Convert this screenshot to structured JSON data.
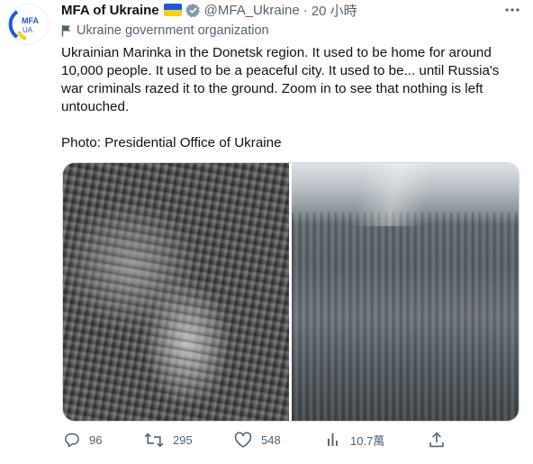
{
  "account": {
    "display_name": "MFA of Ukraine",
    "handle": "@MFA_Ukraine",
    "separator": "·",
    "time": "20 小時",
    "affiliation": "Ukraine government organization",
    "avatar_text_top": "MFA",
    "avatar_text_bottom": "UA"
  },
  "tweet": {
    "text": "Ukrainian Marinka in the Donetsk region. It used to be home for around 10,000 people. It used to be a peaceful city. It used to be... until Russia's war criminals razed it to the ground. Zoom in to see that nothing is left untouched.",
    "photo_credit": "Photo: Presidential Office of Ukraine"
  },
  "actions": {
    "reply_count": "96",
    "retweet_count": "295",
    "like_count": "548",
    "views_count": "10.7萬"
  },
  "colors": {
    "text_primary": "#0f1419",
    "text_secondary": "#536471",
    "flag_blue": "#1f5bd6",
    "flag_yellow": "#f7d01a",
    "badge_gray": "#829aab"
  },
  "icons": [
    "more-icon",
    "flag-icon",
    "verified-badge-icon",
    "reply-icon",
    "retweet-icon",
    "like-icon",
    "views-icon",
    "share-icon"
  ]
}
